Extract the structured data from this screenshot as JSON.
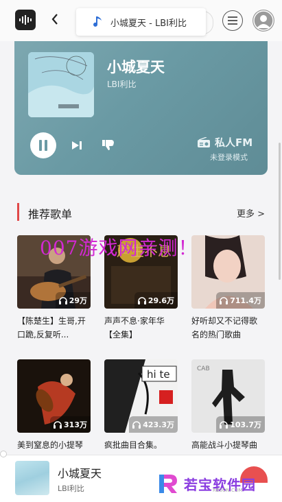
{
  "header": {
    "now_playing": "小城夏天 - LBI利比"
  },
  "player": {
    "title": "小城夏天",
    "artist": "LBI利比",
    "fm_label": "私人FM",
    "fm_status": "未登录模式"
  },
  "section": {
    "title": "推荐歌单",
    "more": "更多 >"
  },
  "playlists": [
    {
      "name": "【陈楚生】生哥,开口跪,反复听...",
      "count": "29万"
    },
    {
      "name": "声声不息·家年华【全集】",
      "count": "29.6万"
    },
    {
      "name": "好听却又不记得歌名的热门歌曲",
      "count": "711.4万"
    },
    {
      "name": "美到窒息的小提琴",
      "count": "313万"
    },
    {
      "name": "疯批曲目合集。",
      "count": "423.3万"
    },
    {
      "name": "高能战斗小提琴曲",
      "count": "103.7万"
    }
  ],
  "watermark": "007游戏网亲测！",
  "mini_player": {
    "title": "小城夏天",
    "artist": "LBI利比"
  },
  "brand": {
    "name": "若宝软件园",
    "url": "RBSON.COM"
  },
  "colors": {
    "accent": "#e04848",
    "player_bg": "#6a9aa4"
  }
}
